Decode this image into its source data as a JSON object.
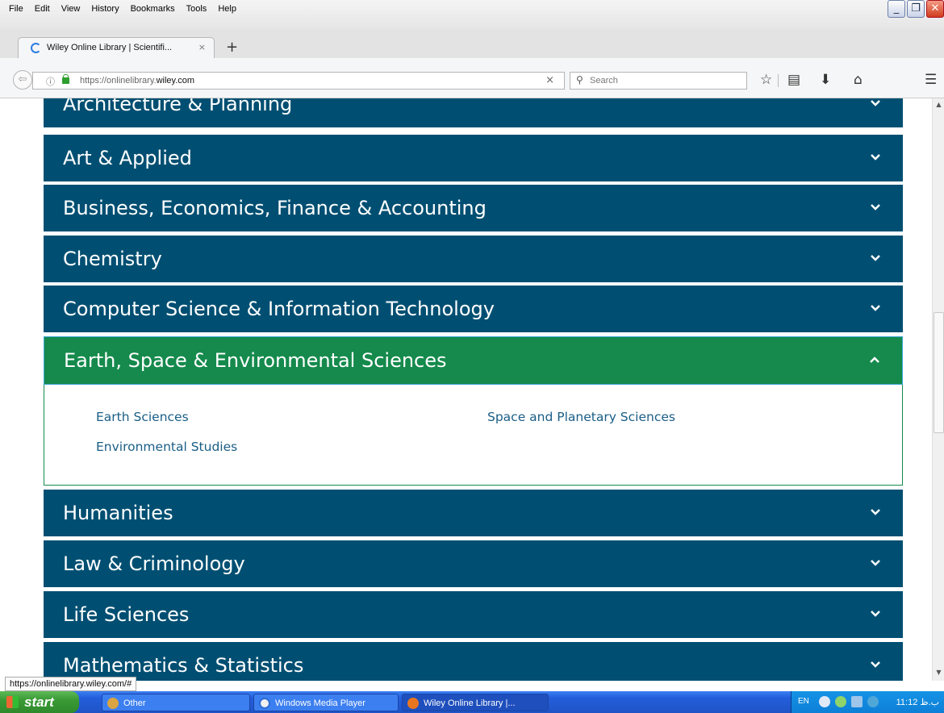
{
  "menu": [
    "File",
    "Edit",
    "View",
    "History",
    "Bookmarks",
    "Tools",
    "Help"
  ],
  "tab": {
    "title": "Wiley Online Library | Scientifi...",
    "close": "×",
    "new_tab": "+"
  },
  "nav": {
    "url_prefix": "https://onlinelibrary.",
    "url_domain": "wiley.com",
    "clear": "×",
    "search_placeholder": "Search"
  },
  "accordion": [
    {
      "label": "Architecture & Planning",
      "state": "collapsed"
    },
    {
      "label": "Art & Applied",
      "state": "collapsed"
    },
    {
      "label": "Business, Economics, Finance & Accounting",
      "state": "collapsed"
    },
    {
      "label": "Chemistry",
      "state": "collapsed"
    },
    {
      "label": "Computer Science & Information Technology",
      "state": "collapsed"
    },
    {
      "label": "Earth, Space & Environmental Sciences",
      "state": "expanded"
    },
    {
      "label": "Humanities",
      "state": "collapsed"
    },
    {
      "label": "Law & Criminology",
      "state": "collapsed"
    },
    {
      "label": "Life Sciences",
      "state": "collapsed"
    },
    {
      "label": "Mathematics & Statistics",
      "state": "collapsed"
    }
  ],
  "expanded_links": [
    "Earth Sciences",
    "Space and Planetary Sciences",
    "Environmental Studies"
  ],
  "status_url": "https://onlinelibrary.wiley.com/#",
  "taskbar": {
    "start": "start",
    "items": [
      "Other",
      "Windows Media Player",
      "Wiley Online Library |..."
    ],
    "lang": "EN",
    "clock": "11:12 ب.ظ"
  },
  "colors": {
    "accordion_bg": "#004f72",
    "active_bg": "#158a4c",
    "link": "#1a5e86"
  }
}
